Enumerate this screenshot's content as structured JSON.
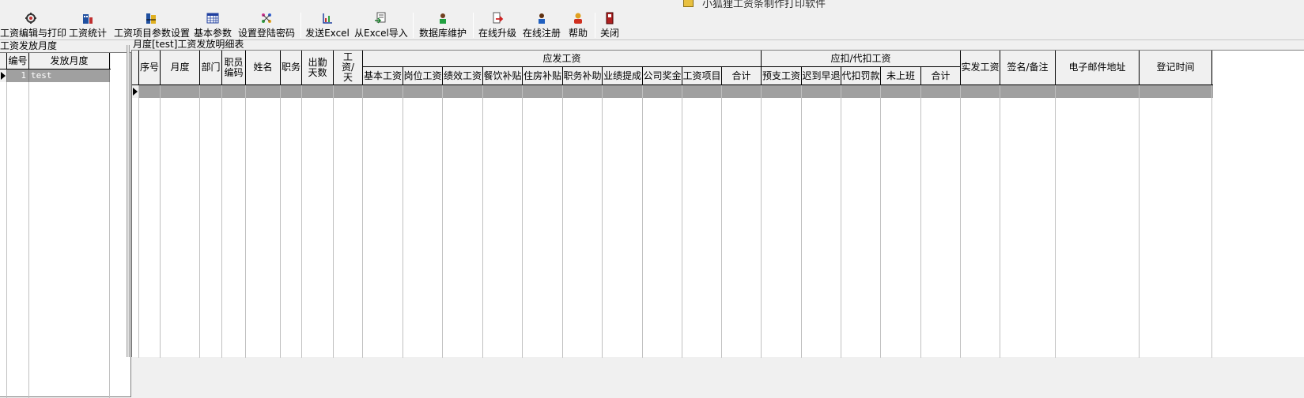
{
  "window": {
    "title": "小狐狸工资条制作打印软件"
  },
  "toolbar": {
    "buttons": [
      {
        "id": "salary-edit-print",
        "label": "工资编辑与打印",
        "icon": "gear-icon"
      },
      {
        "id": "salary-stats",
        "label": "工资统计",
        "icon": "building-chart-icon"
      },
      {
        "id": "salary-item-settings",
        "label": "工资项目参数设置",
        "icon": "table-settings-icon"
      },
      {
        "id": "basic-params",
        "label": "基本参数",
        "icon": "calendar-grid-icon"
      },
      {
        "id": "login-password",
        "label": "设置登陆密码",
        "icon": "password-dots-icon"
      },
      {
        "id": "send-excel",
        "label": "发送Excel",
        "icon": "chart-send-icon"
      },
      {
        "id": "import-excel",
        "label": "从Excel导入",
        "icon": "import-icon"
      },
      {
        "id": "db-maintenance",
        "label": "数据库维护",
        "icon": "user-db-icon"
      },
      {
        "id": "online-upgrade",
        "label": "在线升级",
        "icon": "upgrade-arrow-icon"
      },
      {
        "id": "online-register",
        "label": "在线注册",
        "icon": "user-register-icon"
      },
      {
        "id": "help",
        "label": "帮助",
        "icon": "help-person-icon"
      },
      {
        "id": "close",
        "label": "关闭",
        "icon": "exit-door-icon"
      }
    ]
  },
  "left_panel": {
    "caption": "工资发放月度",
    "columns": [
      "编号",
      "发放月度"
    ],
    "rows": [
      {
        "no": "1",
        "month": "test"
      }
    ]
  },
  "right_panel": {
    "caption": "月度[test]工资发放明细表",
    "columns": {
      "seq": "序号",
      "month": "月度",
      "dept": "部门",
      "emp_code": "职员编码",
      "name": "姓名",
      "position": "职务",
      "attendance_days": "出勤天数",
      "wage_per_day": "工资/天",
      "payable_group": "应发工资",
      "payable": [
        "基本工资",
        "岗位工资",
        "绩效工资",
        "餐饮补贴",
        "住房补贴",
        "职务补助",
        "业绩提成",
        "公司奖金",
        "工资项目",
        "合计"
      ],
      "deduct_group": "应扣/代扣工资",
      "deduct": [
        "预支工资",
        "迟到早退",
        "代扣罚款",
        "未上班",
        "合计"
      ],
      "net_pay": "实发工资",
      "signature_note": "签名/备注",
      "email": "电子邮件地址",
      "register_time": "登记时间"
    }
  }
}
